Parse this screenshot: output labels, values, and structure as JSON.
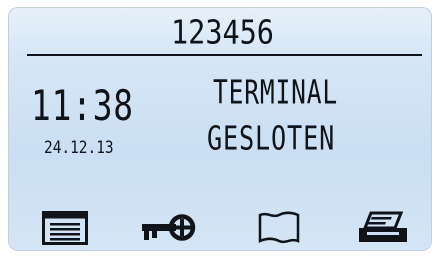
{
  "terminal_display": {
    "header_value": "123456",
    "time": "11:38",
    "date": "24.12.13",
    "status_line_1": "TERMINAL",
    "status_line_2": "GESLOTEN"
  },
  "softkeys": [
    {
      "icon": "menu-list-icon"
    },
    {
      "icon": "key-icon"
    },
    {
      "icon": "flag-icon"
    },
    {
      "icon": "printer-icon"
    }
  ],
  "colors": {
    "lcd_background": "#cadff3",
    "lcd_text": "#101418"
  }
}
